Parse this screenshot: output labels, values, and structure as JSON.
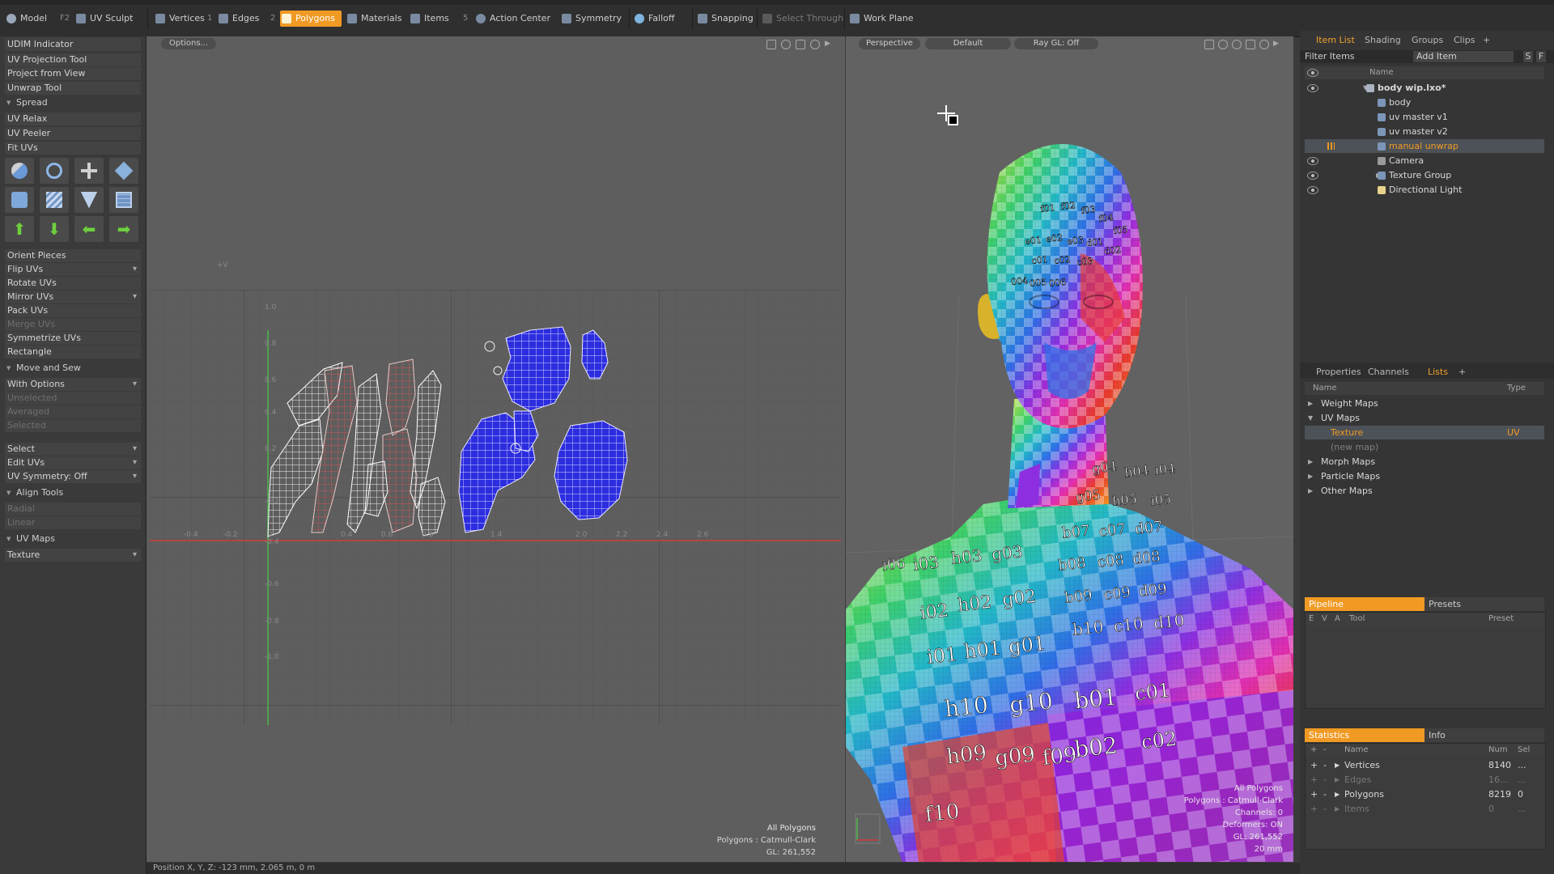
{
  "toolbar": {
    "model": "Model",
    "f2": "F2",
    "uv_sculpt": "UV Sculpt",
    "vertices": "Vertices",
    "n1": "1",
    "edges": "Edges",
    "n2": "2",
    "polygons": "Polygons",
    "materials": "Materials",
    "items": "Items",
    "n5": "5",
    "action_center": "Action Center",
    "symmetry": "Symmetry",
    "falloff": "Falloff",
    "snapping": "Snapping",
    "select_through": "Select Through",
    "work_plane": "Work Plane",
    "accent": "#f09a24"
  },
  "left": {
    "udim": "UDIM Indicator",
    "uv_projection": "UV Projection Tool",
    "project_from_view": "Project from View",
    "unwrap_tool": "Unwrap Tool",
    "spread": "Spread",
    "uv_relax": "UV Relax",
    "uv_peeler": "UV Peeler",
    "fit_uvs": "Fit UVs",
    "orient_pieces": "Orient Pieces",
    "flip_uvs": "Flip UVs",
    "rotate_uvs": "Rotate UVs",
    "mirror_uvs": "Mirror UVs",
    "pack_uvs": "Pack UVs",
    "merge_uvs": "Merge UVs",
    "symmetrize_uvs": "Symmetrize UVs",
    "rectangle": "Rectangle",
    "move_and_sew": "Move and Sew",
    "with_options": "With Options",
    "unselected": "Unselected",
    "averaged": "Averaged",
    "selected": "Selected",
    "select": "Select",
    "edit_uvs": "Edit UVs",
    "uv_symmetry": "UV Symmetry: Off",
    "align_tools": "Align Tools",
    "radial": "Radial",
    "linear": "Linear",
    "uv_maps": "UV Maps",
    "texture": "Texture"
  },
  "uv": {
    "options": "Options...",
    "plus_v": "+V",
    "ticks_v": [
      "1.0",
      "0.8",
      "0.6",
      "0.4",
      "0.2",
      "-0.2",
      "-0.4",
      "-0.6",
      "-0.8",
      "-1.0"
    ],
    "ticks_u": [
      "-0.4",
      "-0.2",
      "0",
      "0.4",
      "0.6",
      "0.8",
      "1.4",
      "2.0",
      "2.2",
      "2.4",
      "2.6"
    ],
    "overlay": [
      "All Polygons",
      "Polygons : Catmull-Clark",
      "GL: 261,552"
    ]
  },
  "persp": {
    "view": "Perspective",
    "shade": "Default",
    "raygl": "Ray GL: Off",
    "overlay": [
      "All Polygons",
      "Polygons : Catmull-Clark",
      "Channels: 0",
      "Deformers: ON",
      "GL: 261,552",
      "20 mm"
    ],
    "labels": [
      "f01",
      "f02",
      "f03",
      "f04",
      "f05",
      "e01",
      "e02",
      "e03",
      "d01",
      "d02",
      "c01",
      "c02",
      "c03",
      "004",
      "005",
      "006",
      "g04",
      "h04",
      "i04",
      "g05",
      "h05",
      "i05",
      "b07",
      "c07",
      "d07",
      "b08",
      "c08",
      "d08",
      "b09",
      "c09",
      "d09",
      "b10",
      "c10",
      "d10",
      "i01",
      "h01",
      "g01",
      "i02",
      "h02",
      "g02",
      "i03",
      "h03",
      "g03",
      "b01",
      "c01",
      "b02",
      "c02",
      "h10",
      "g10",
      "i06",
      "h09",
      "g09",
      "f09",
      "f10"
    ]
  },
  "items": {
    "tabs": [
      "Item List",
      "Shading",
      "Groups",
      "Clips",
      "+"
    ],
    "filter": "Filter Items",
    "add_item": "Add Item",
    "s": "S",
    "f": "F",
    "name_col": "Name",
    "rows": [
      "body wip.lxo*",
      "body",
      "uv master v1",
      "uv master v2",
      "manual unwrap",
      "Camera",
      "Texture Group",
      "Directional Light"
    ]
  },
  "lists": {
    "tabs": [
      "Properties",
      "Channels",
      "Lists",
      "+"
    ],
    "name_col": "Name",
    "type_col": "Type",
    "rows": [
      "Weight Maps",
      "UV Maps",
      "Texture",
      "(new map)",
      "Morph Maps",
      "Particle Maps",
      "Other Maps"
    ],
    "texture_type": "UV"
  },
  "pipeline": {
    "tab": "Pipeline",
    "presets": "Presets",
    "cols": [
      "E",
      "V",
      "A",
      "Tool",
      "Preset"
    ]
  },
  "stats": {
    "tab": "Statistics",
    "info": "Info",
    "cols": [
      "Name",
      "Num",
      "Sel"
    ],
    "rows": [
      {
        "name": "Vertices",
        "num": "8140",
        "sel": "..."
      },
      {
        "name": "Edges",
        "num": "16...",
        "sel": "..."
      },
      {
        "name": "Polygons",
        "num": "8219",
        "sel": "0"
      },
      {
        "name": "Items",
        "num": "0",
        "sel": "..."
      }
    ]
  },
  "status": "Position X, Y, Z:  -123 mm,  2.065 m,  0 m"
}
